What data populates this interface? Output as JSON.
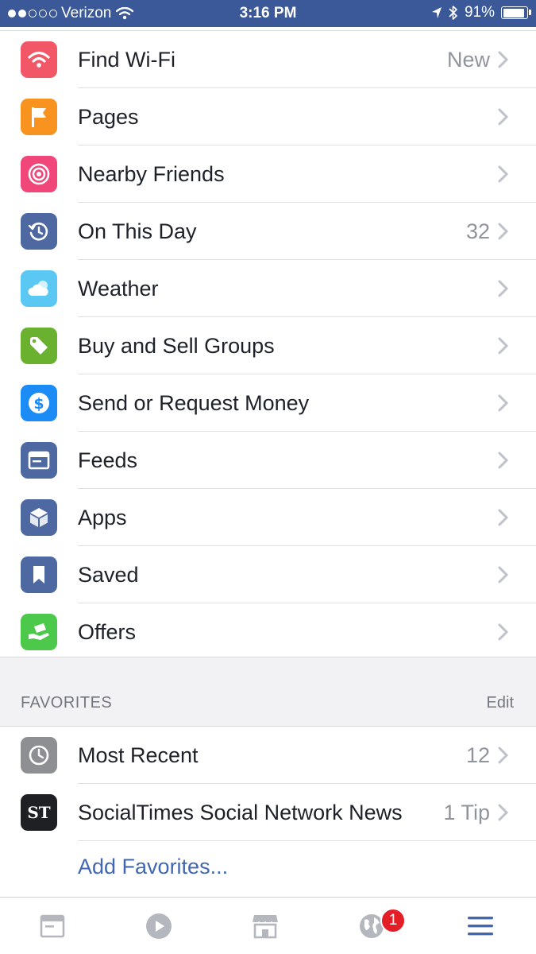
{
  "status_bar": {
    "carrier": "Verizon",
    "time": "3:16 PM",
    "battery": "91%",
    "battery_level": 0.91
  },
  "menu": {
    "items": [
      {
        "label": "Find Wi-Fi",
        "value": "New",
        "icon": "wifi-icon",
        "color": "#f25767"
      },
      {
        "label": "Pages",
        "value": "",
        "icon": "flag-icon",
        "color": "#f7931e"
      },
      {
        "label": "Nearby Friends",
        "value": "",
        "icon": "nearby-friends-icon",
        "color": "#f1467a"
      },
      {
        "label": "On This Day",
        "value": "32",
        "icon": "history-icon",
        "color": "#4e69a2"
      },
      {
        "label": "Weather",
        "value": "",
        "icon": "cloud-icon",
        "color": "#5ac8f2"
      },
      {
        "label": "Buy and Sell Groups",
        "value": "",
        "icon": "price-tag-icon",
        "color": "#6bb130"
      },
      {
        "label": "Send or Request Money",
        "value": "",
        "icon": "dollar-icon",
        "color": "#1b8cf5"
      },
      {
        "label": "Feeds",
        "value": "",
        "icon": "feed-icon",
        "color": "#4e69a2"
      },
      {
        "label": "Apps",
        "value": "",
        "icon": "cube-icon",
        "color": "#4e69a2"
      },
      {
        "label": "Saved",
        "value": "",
        "icon": "bookmark-icon",
        "color": "#4e69a2"
      },
      {
        "label": "Offers",
        "value": "",
        "icon": "offer-hand-icon",
        "color": "#4cc84b"
      }
    ]
  },
  "favorites": {
    "title": "FAVORITES",
    "edit_label": "Edit",
    "items": [
      {
        "label": "Most Recent",
        "value": "12",
        "icon": "clock-icon",
        "color": "#8d8f92"
      },
      {
        "label": "SocialTimes Social Network News",
        "value": "1 Tip",
        "icon": "socialtimes-logo",
        "logo_text": "ST",
        "color": "#1f2024"
      }
    ],
    "add_label": "Add Favorites..."
  },
  "tabbar": {
    "tabs": [
      {
        "name": "news-feed",
        "icon": "news-feed-icon"
      },
      {
        "name": "video",
        "icon": "play-icon"
      },
      {
        "name": "marketplace",
        "icon": "store-icon"
      },
      {
        "name": "notifications",
        "icon": "globe-icon"
      },
      {
        "name": "menu",
        "icon": "hamburger-icon"
      }
    ],
    "notification_badge": "1",
    "active_color": "#4267b2"
  }
}
